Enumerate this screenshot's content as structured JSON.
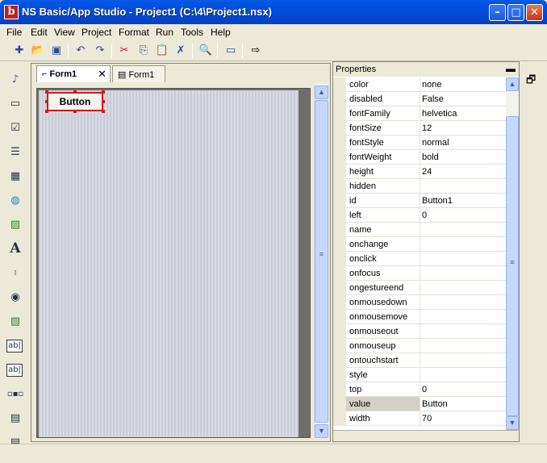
{
  "window": {
    "title": "NS Basic/App Studio - Project1 (C:\\4\\Project1.nsx)",
    "app_icon": "b",
    "minimize_icon": "minimize-icon",
    "maximize_icon": "maximize-icon",
    "close_icon": "close-icon"
  },
  "menu": [
    "File",
    "Edit",
    "View",
    "Project",
    "Format",
    "Run",
    "Tools",
    "Help"
  ],
  "toolbar": [
    "new-project-icon",
    "open-icon",
    "save-icon",
    "undo-icon",
    "redo-icon",
    "cut-icon",
    "copy-icon",
    "paste-icon",
    "delete-icon",
    "find-icon",
    "new-form-icon",
    "run-icon"
  ],
  "toolbox": [
    "audio-icon",
    "button-icon",
    "checkbox-icon",
    "list-icon",
    "grid-icon",
    "globe-icon",
    "image-icon",
    "text-label-icon",
    "textarea-icon",
    "radio-icon",
    "picture-icon",
    "textbox-icon",
    "input-icon",
    "slider-icon",
    "select-icon",
    "document-icon"
  ],
  "tabs": [
    {
      "label": "Form1",
      "active": true
    },
    {
      "label": "Form1",
      "active": false
    }
  ],
  "canvas": {
    "button_label": "Button"
  },
  "properties": {
    "title": "Properties",
    "rows": [
      {
        "name": "color",
        "value": "none"
      },
      {
        "name": "disabled",
        "value": "False"
      },
      {
        "name": "fontFamily",
        "value": "helvetica"
      },
      {
        "name": "fontSize",
        "value": "12"
      },
      {
        "name": "fontStyle",
        "value": "normal"
      },
      {
        "name": "fontWeight",
        "value": "bold"
      },
      {
        "name": "height",
        "value": "24"
      },
      {
        "name": "hidden",
        "value": ""
      },
      {
        "name": "id",
        "value": "Button1"
      },
      {
        "name": "left",
        "value": "0"
      },
      {
        "name": "name",
        "value": ""
      },
      {
        "name": "onchange",
        "value": ""
      },
      {
        "name": "onclick",
        "value": ""
      },
      {
        "name": "onfocus",
        "value": ""
      },
      {
        "name": "ongestureend",
        "value": ""
      },
      {
        "name": "onmousedown",
        "value": ""
      },
      {
        "name": "onmousemove",
        "value": ""
      },
      {
        "name": "onmouseout",
        "value": ""
      },
      {
        "name": "onmouseup",
        "value": ""
      },
      {
        "name": "ontouchstart",
        "value": ""
      },
      {
        "name": "style",
        "value": ""
      },
      {
        "name": "top",
        "value": "0"
      },
      {
        "name": "value",
        "value": "Button",
        "selected": true
      },
      {
        "name": "width",
        "value": "70"
      }
    ]
  },
  "colors": {
    "titlebar": "#0055e4",
    "selection": "#d21b1b",
    "chrome": "#ece9d8"
  }
}
